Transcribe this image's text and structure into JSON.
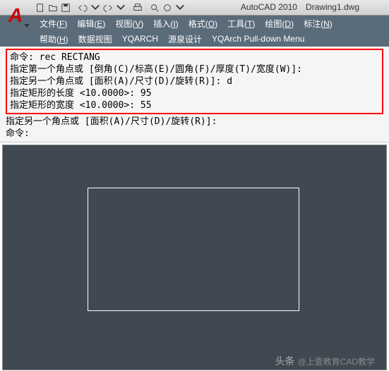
{
  "title": {
    "app": "AutoCAD 2010",
    "doc": "Drawing1.dwg"
  },
  "menu1": [
    {
      "label": "文件(F)",
      "name": "menu-file"
    },
    {
      "label": "编辑(E)",
      "name": "menu-edit"
    },
    {
      "label": "视图(V)",
      "name": "menu-view"
    },
    {
      "label": "插入(I)",
      "name": "menu-insert"
    },
    {
      "label": "格式(O)",
      "name": "menu-format"
    },
    {
      "label": "工具(T)",
      "name": "menu-tools"
    },
    {
      "label": "绘图(D)",
      "name": "menu-draw"
    },
    {
      "label": "标注(N)",
      "name": "menu-dimension"
    }
  ],
  "menu2": [
    {
      "label": "帮助(H)",
      "name": "menu-help"
    },
    {
      "label": "数据视图",
      "name": "menu-dataview"
    },
    {
      "label": "YQARCH",
      "name": "menu-yqarch"
    },
    {
      "label": "源泉设计",
      "name": "menu-yuanquan"
    },
    {
      "label": "YQArch Pull-down Menu",
      "name": "menu-yqarch-pull"
    }
  ],
  "cmd": {
    "l1": "命令: rec RECTANG",
    "l2": "指定第一个角点或 [倒角(C)/标高(E)/圆角(F)/厚度(T)/宽度(W)]:",
    "l3": "指定另一个角点或 [面积(A)/尺寸(D)/旋转(R)]: d",
    "l4": "指定矩形的长度 <10.0000>: 95",
    "l5": "指定矩形的宽度 <10.0000>: 55",
    "l6": "指定另一个角点或 [面积(A)/尺寸(D)/旋转(R)]:",
    "prompt": "命令:"
  },
  "footer": {
    "icon": "头条",
    "text": "@上壹教育CAD教学"
  }
}
